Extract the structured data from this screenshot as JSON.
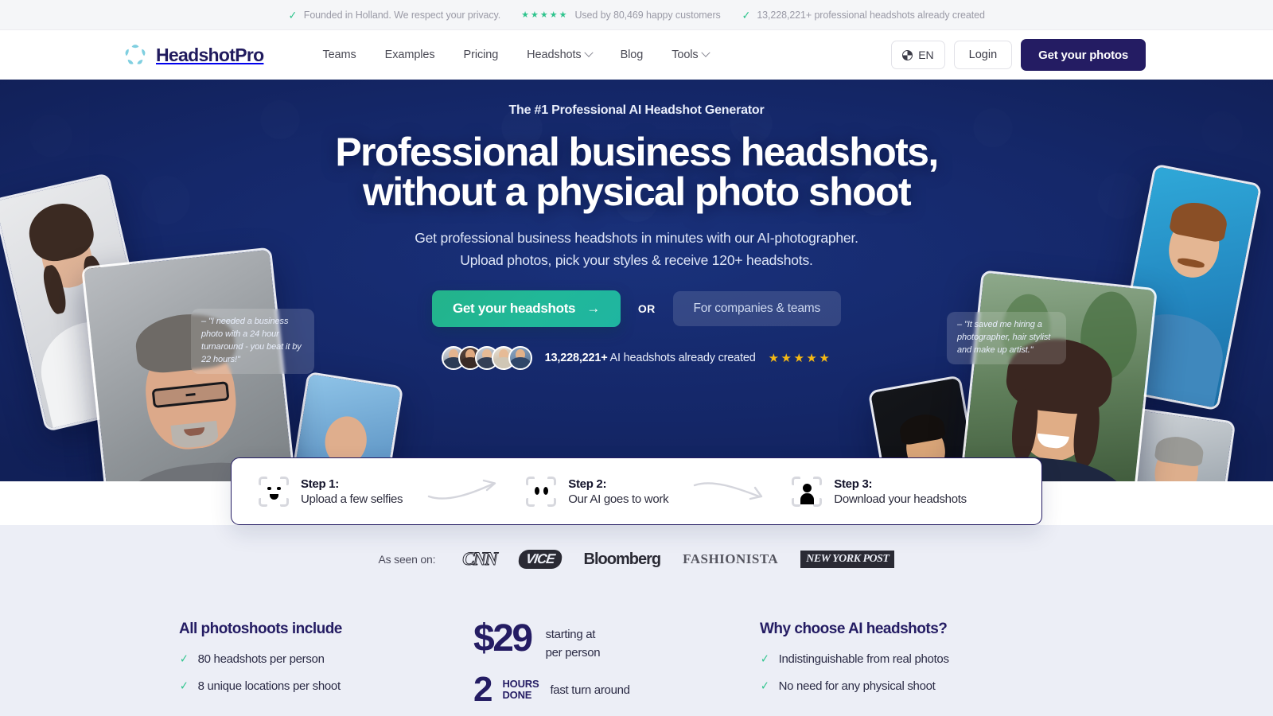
{
  "topbar": {
    "items": [
      {
        "icon": "check-icon",
        "text": "Founded in Holland. We respect your privacy."
      },
      {
        "icon": "stars-icon",
        "stars": "★★★★★",
        "text": "Used by 80,469 happy customers"
      },
      {
        "icon": "check-icon",
        "text": "13,228,221+ professional headshots already created"
      }
    ]
  },
  "header": {
    "brand": "HeadshotPro",
    "nav": [
      {
        "label": "Teams",
        "dropdown": false
      },
      {
        "label": "Examples",
        "dropdown": false
      },
      {
        "label": "Pricing",
        "dropdown": false
      },
      {
        "label": "Headshots",
        "dropdown": true
      },
      {
        "label": "Blog",
        "dropdown": false
      },
      {
        "label": "Tools",
        "dropdown": true
      }
    ],
    "language": "EN",
    "login": "Login",
    "cta": "Get your photos"
  },
  "hero": {
    "eyebrow": "The #1 Professional AI Headshot Generator",
    "title_line1": "Professional business headshots,",
    "title_line2": "without a physical photo shoot",
    "sub_line1": "Get professional business headshots in minutes with our AI-photographer.",
    "sub_line2": "Upload photos, pick your styles & receive 120+ headshots.",
    "cta_primary": "Get your headshots",
    "cta_arrow": "→",
    "or": "OR",
    "cta_secondary": "For companies & teams",
    "proof_count": "13,228,221+",
    "proof_text": "AI headshots already created",
    "proof_stars": "★★★★★",
    "quote_left": "– \"I needed a business photo with a 24 hour turnaround - you beat it by 22 hours!\"",
    "quote_right": "– \"It saved me hiring a photographer, hair stylist and make up artist.\""
  },
  "steps": [
    {
      "title": "Step 1:",
      "desc": "Upload a few selfies",
      "icon": "face-frame-icon"
    },
    {
      "title": "Step 2:",
      "desc": "Our AI goes to work",
      "icon": "eyes-frame-icon"
    },
    {
      "title": "Step 3:",
      "desc": "Download your headshots",
      "icon": "person-frame-icon"
    }
  ],
  "press": {
    "label": "As seen on:",
    "logos": [
      "CNN",
      "VICE",
      "Bloomberg",
      "FASHIONISTA",
      "NEW YORK POST"
    ]
  },
  "features": {
    "left": {
      "heading": "All photoshoots include",
      "items": [
        "80 headshots per person",
        "8 unique locations per shoot"
      ]
    },
    "middle": {
      "price": "$29",
      "price_note_1": "starting at",
      "price_note_2": "per person",
      "hours_num": "2",
      "hours_label_1": "HOURS",
      "hours_label_2": "DONE",
      "hours_text": "fast turn around"
    },
    "right": {
      "heading": "Why choose AI headshots?",
      "items": [
        "Indistinguishable from real photos",
        "No need for any physical shoot"
      ]
    }
  },
  "colors": {
    "brand_navy": "#241c63",
    "accent_green": "#21b899",
    "check_green": "#2fc48d",
    "star_gold": "#f5b914",
    "hero_blue": "#1e3a8a",
    "band_gray": "#eceef6"
  }
}
